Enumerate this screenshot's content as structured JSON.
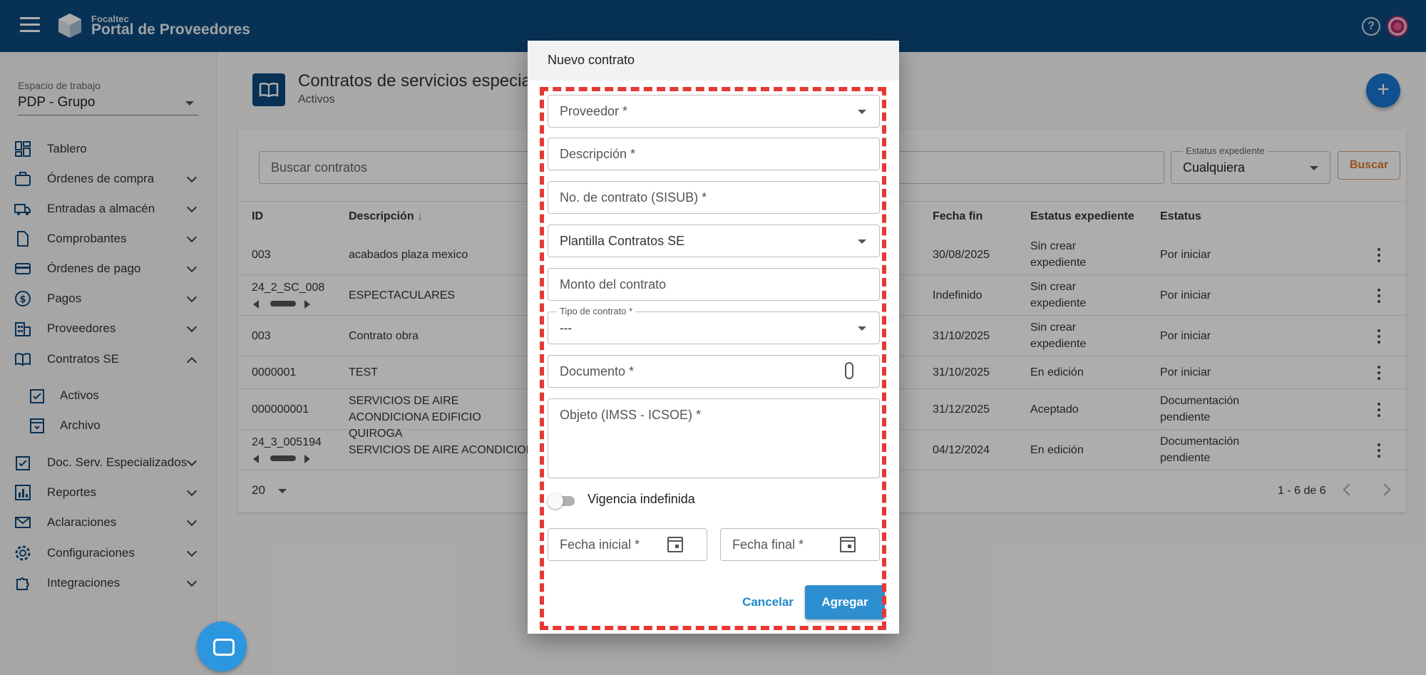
{
  "header": {
    "brand_small": "Focaltec",
    "brand_big": "Portal de Proveedores",
    "help_icon": "help-icon",
    "avatar_icon": "avatar"
  },
  "sidebar": {
    "workspace_label": "Espacio de trabajo",
    "workspace_value": "PDP - Grupo",
    "items": [
      {
        "label": "Tablero",
        "icon": "dashboard-icon"
      },
      {
        "label": "Órdenes de compra",
        "icon": "cart-icon"
      },
      {
        "label": "Entradas a almacén",
        "icon": "truck-icon"
      },
      {
        "label": "Comprobantes",
        "icon": "document-icon"
      },
      {
        "label": "Órdenes de pago",
        "icon": "card-icon"
      },
      {
        "label": "Pagos",
        "icon": "dollar-icon"
      },
      {
        "label": "Proveedores",
        "icon": "building-icon"
      },
      {
        "label": "Contratos SE",
        "icon": "book-icon"
      },
      {
        "label": "Activos",
        "icon": "check-clipboard-icon"
      },
      {
        "label": "Archivo",
        "icon": "archive-icon"
      },
      {
        "label": "Doc. Serv. Especializados",
        "icon": "check-clipboard-icon"
      },
      {
        "label": "Reportes",
        "icon": "chart-icon"
      },
      {
        "label": "Aclaraciones",
        "icon": "mail-icon"
      },
      {
        "label": "Configuraciones",
        "icon": "gear-icon"
      },
      {
        "label": "Integraciones",
        "icon": "puzzle-icon"
      }
    ]
  },
  "main": {
    "title": "Contratos de servicios especializ",
    "subtitle": "Activos",
    "search_placeholder": "Buscar contratos",
    "status_label": "Estatus expediente",
    "status_value": "Cualquiera",
    "search_button": "Buscar",
    "columns": [
      "ID",
      "Descripción",
      "Fecha fin",
      "Estatus expediente",
      "Estatus"
    ],
    "rows": [
      {
        "id": "003",
        "desc": "acabados plaza mexico",
        "end": "30/08/2025",
        "exp": "Sin crear expediente",
        "status": "Por iniciar"
      },
      {
        "id": "24_2_SC_008",
        "desc": "ESPECTACULARES",
        "end": "Indefinido",
        "exp": "Sin crear expediente",
        "status": "Por iniciar"
      },
      {
        "id": "003",
        "desc": "Contrato obra",
        "end": "31/10/2025",
        "exp": "Sin crear expediente",
        "status": "Por iniciar"
      },
      {
        "id": "0000001",
        "desc": "TEST",
        "end": "31/10/2025",
        "exp": "En edición",
        "status": "Por iniciar"
      },
      {
        "id": "000000001",
        "desc": "SERVICIOS DE AIRE ACONDICIONA EDIFICIO QUIROGA",
        "end": "31/12/2025",
        "exp": "Aceptado",
        "status": "Documentación pendiente"
      },
      {
        "id": "24_3_005194",
        "desc": "SERVICIOS DE AIRE ACONDICIONA",
        "end": "04/12/2024",
        "exp": "En edición",
        "status": "Documentación pendiente"
      }
    ],
    "page_size": "20",
    "range": "1 - 6 de 6"
  },
  "dialog": {
    "title": "Nuevo contrato",
    "proveedor": "Proveedor *",
    "descripcion": "Descripción *",
    "no_contrato": "No. de contrato (SISUB) *",
    "plantilla": "Plantilla Contratos SE",
    "monto": "Monto del contrato",
    "tipo_label": "Tipo de contrato *",
    "tipo_value": "---",
    "documento": "Documento *",
    "objeto": "Objeto (IMSS - ICSOE) *",
    "vigencia": "Vigencia indefinida",
    "fecha_inicial": "Fecha inicial *",
    "fecha_final": "Fecha final *",
    "cancel": "Cancelar",
    "add": "Agregar"
  },
  "colors": {
    "header": "#0d4a7e",
    "accent": "#2e8fd0",
    "highlight": "#e53935"
  }
}
